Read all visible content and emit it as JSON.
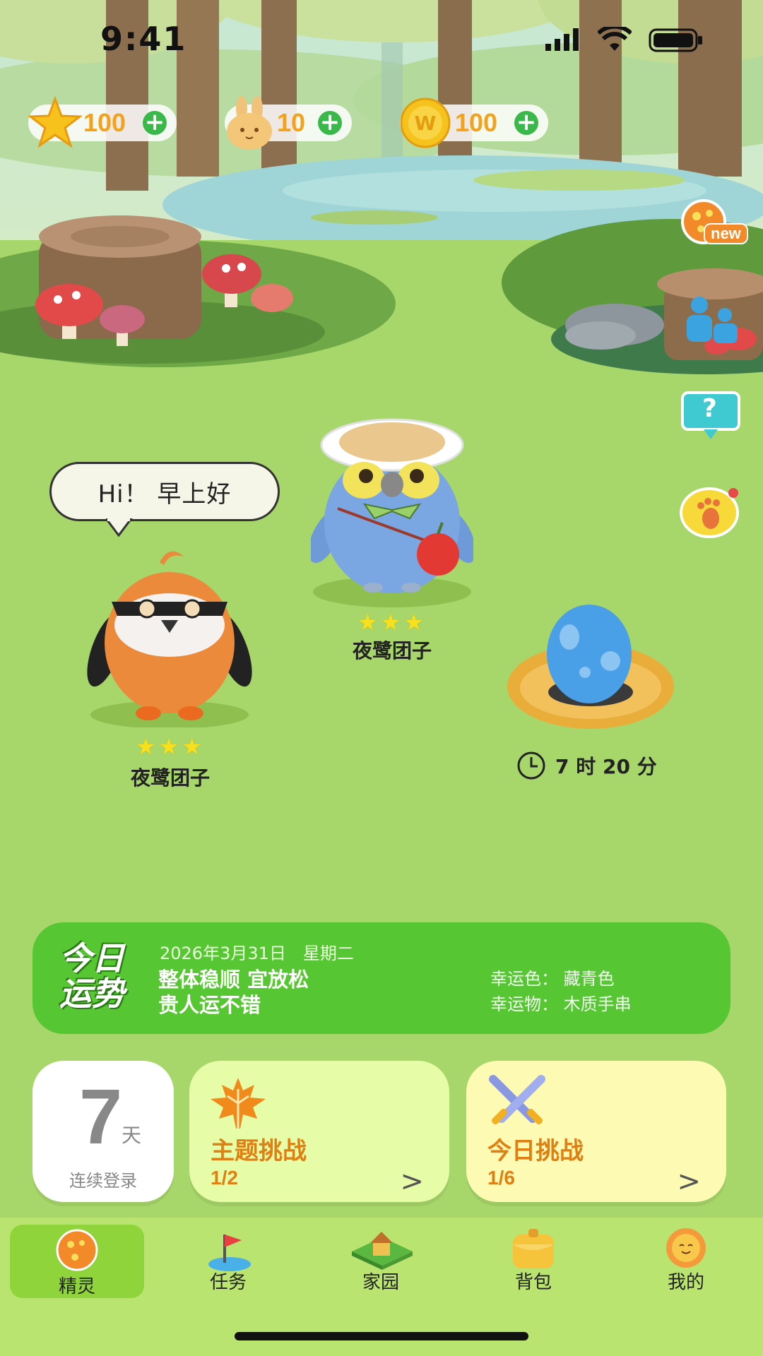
{
  "status_bar": {
    "time": "9:41"
  },
  "currencies": [
    {
      "name": "star",
      "value": "100"
    },
    {
      "name": "rabbit-coin",
      "value": "10"
    },
    {
      "name": "gold-coin",
      "value": "100",
      "coin_letter": "W"
    }
  ],
  "side_buttons": {
    "new_badge": "new",
    "help_mark": "?"
  },
  "speech_bubble": {
    "text": "Hi！ 早上好"
  },
  "pets": [
    {
      "name": "夜鹭团子",
      "stars": "★★★"
    },
    {
      "name": "夜鹭团子",
      "stars": "★★★"
    }
  ],
  "egg": {
    "timer": "7 时 20 分"
  },
  "fortune": {
    "badge_line1": "今日",
    "badge_line2": "运势",
    "date": "2026年3月31日　星期二",
    "line1": "整体稳顺 宜放松",
    "line2": "贵人运不错",
    "lucky_color_label": "幸运色：",
    "lucky_color": "藏青色",
    "lucky_item_label": "幸运物：",
    "lucky_item": "木质手串"
  },
  "login_card": {
    "days": "7",
    "unit": "天",
    "label": "连续登录"
  },
  "theme_challenge": {
    "title": "主题挑战",
    "progress": "1/2"
  },
  "today_challenge": {
    "title": "今日挑战",
    "progress": "1/6"
  },
  "nav": [
    {
      "label": "精灵",
      "active": true
    },
    {
      "label": "任务"
    },
    {
      "label": "家园"
    },
    {
      "label": "背包"
    },
    {
      "label": "我的"
    }
  ],
  "colors": {
    "grass": "#a7d66a",
    "fortune_green": "#56c632",
    "accent_orange": "#e07f12",
    "nav_bg": "#b9e46f"
  }
}
